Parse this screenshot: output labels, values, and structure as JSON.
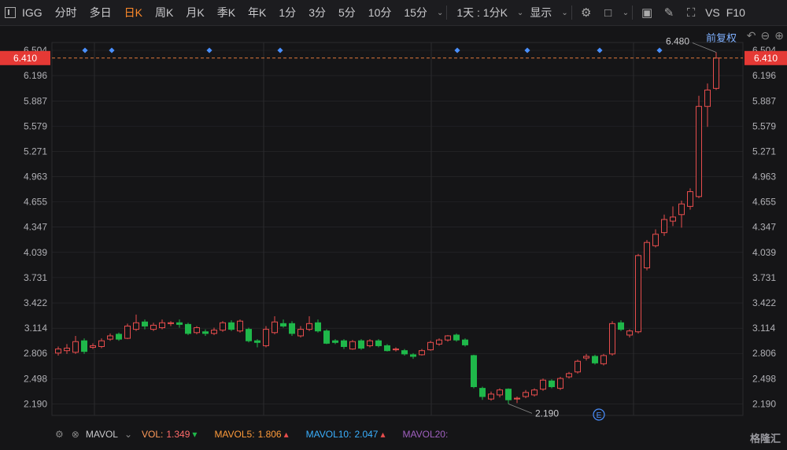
{
  "toolbar": {
    "symbol": "IGG",
    "periods": [
      "分时",
      "多日",
      "日K",
      "周K",
      "月K",
      "季K",
      "年K",
      "1分",
      "3分",
      "5分",
      "10分",
      "15分"
    ],
    "active_period": "日K",
    "interval_select": "1天 : 1分K",
    "display_label": "显示",
    "vs_label": "VS",
    "f10_label": "F10"
  },
  "chart_header": {
    "adjust_label": "前复权"
  },
  "price_marker": {
    "current": "6.410",
    "color": "#e53935",
    "high_label": "6.480",
    "low_label": "2.190",
    "event_badge": "E"
  },
  "colors": {
    "up": "#e84d4d",
    "down": "#1fb84a",
    "grid": "#2a2a2e",
    "background": "#151517",
    "accent": "#ff8a2a"
  },
  "chart_data": {
    "type": "candlestick",
    "y_ticks": [
      "6.504",
      "6.196",
      "5.887",
      "5.579",
      "5.271",
      "4.963",
      "4.655",
      "4.347",
      "4.039",
      "3.731",
      "3.422",
      "3.114",
      "2.806",
      "2.498",
      "2.190"
    ],
    "ylim": [
      2.05,
      6.6
    ],
    "candles": [
      [
        2.81,
        2.86,
        2.89,
        2.78
      ],
      [
        2.84,
        2.87,
        2.92,
        2.8
      ],
      [
        2.82,
        2.95,
        3.02,
        2.8
      ],
      [
        2.96,
        2.83,
        2.99,
        2.8
      ],
      [
        2.88,
        2.9,
        2.93,
        2.86
      ],
      [
        2.89,
        2.96,
        2.99,
        2.87
      ],
      [
        2.98,
        3.02,
        3.05,
        2.96
      ],
      [
        3.04,
        2.98,
        3.06,
        2.96
      ],
      [
        2.99,
        3.14,
        3.17,
        2.98
      ],
      [
        3.1,
        3.18,
        3.28,
        3.08
      ],
      [
        3.19,
        3.14,
        3.22,
        3.1
      ],
      [
        3.1,
        3.15,
        3.18,
        3.08
      ],
      [
        3.12,
        3.18,
        3.22,
        3.1
      ],
      [
        3.17,
        3.18,
        3.2,
        3.14
      ],
      [
        3.18,
        3.16,
        3.22,
        3.12
      ],
      [
        3.16,
        3.05,
        3.18,
        3.03
      ],
      [
        3.06,
        3.12,
        3.14,
        3.04
      ],
      [
        3.07,
        3.05,
        3.1,
        3.02
      ],
      [
        3.05,
        3.09,
        3.12,
        3.03
      ],
      [
        3.09,
        3.18,
        3.2,
        3.07
      ],
      [
        3.18,
        3.1,
        3.21,
        3.08
      ],
      [
        3.08,
        3.2,
        3.22,
        3.06
      ],
      [
        3.1,
        2.96,
        3.12,
        2.94
      ],
      [
        2.96,
        2.94,
        2.98,
        2.88
      ],
      [
        2.9,
        3.1,
        3.14,
        2.88
      ],
      [
        3.06,
        3.19,
        3.26,
        3.04
      ],
      [
        3.17,
        3.14,
        3.22,
        3.12
      ],
      [
        3.17,
        3.05,
        3.2,
        3.02
      ],
      [
        3.02,
        3.1,
        3.14,
        3.0
      ],
      [
        3.1,
        3.17,
        3.26,
        3.08
      ],
      [
        3.18,
        3.08,
        3.22,
        3.06
      ],
      [
        3.08,
        2.93,
        3.1,
        2.92
      ],
      [
        2.96,
        2.94,
        2.98,
        2.92
      ],
      [
        2.96,
        2.89,
        2.98,
        2.86
      ],
      [
        2.86,
        2.95,
        2.97,
        2.85
      ],
      [
        2.96,
        2.87,
        2.98,
        2.85
      ],
      [
        2.9,
        2.96,
        2.98,
        2.88
      ],
      [
        2.96,
        2.9,
        2.98,
        2.88
      ],
      [
        2.9,
        2.84,
        2.92,
        2.83
      ],
      [
        2.85,
        2.86,
        2.88,
        2.83
      ],
      [
        2.84,
        2.8,
        2.86,
        2.78
      ],
      [
        2.79,
        2.77,
        2.81,
        2.74
      ],
      [
        2.79,
        2.84,
        2.86,
        2.78
      ],
      [
        2.85,
        2.94,
        2.96,
        2.84
      ],
      [
        2.92,
        2.97,
        2.99,
        2.9
      ],
      [
        2.97,
        3.02,
        3.03,
        2.95
      ],
      [
        3.03,
        2.97,
        3.05,
        2.95
      ],
      [
        2.97,
        2.91,
        2.99,
        2.89
      ],
      [
        2.78,
        2.4,
        2.79,
        2.38
      ],
      [
        2.38,
        2.28,
        2.4,
        2.24
      ],
      [
        2.25,
        2.31,
        2.34,
        2.23
      ],
      [
        2.3,
        2.36,
        2.38,
        2.27
      ],
      [
        2.37,
        2.24,
        2.38,
        2.19
      ],
      [
        2.25,
        2.26,
        2.28,
        2.2
      ],
      [
        2.28,
        2.33,
        2.36,
        2.26
      ],
      [
        2.3,
        2.36,
        2.38,
        2.28
      ],
      [
        2.37,
        2.48,
        2.5,
        2.35
      ],
      [
        2.47,
        2.4,
        2.49,
        2.38
      ],
      [
        2.38,
        2.5,
        2.52,
        2.36
      ],
      [
        2.52,
        2.56,
        2.58,
        2.5
      ],
      [
        2.58,
        2.71,
        2.73,
        2.56
      ],
      [
        2.75,
        2.77,
        2.8,
        2.72
      ],
      [
        2.77,
        2.69,
        2.79,
        2.67
      ],
      [
        2.68,
        2.78,
        2.8,
        2.66
      ],
      [
        2.8,
        3.17,
        3.2,
        2.78
      ],
      [
        3.18,
        3.1,
        3.21,
        3.08
      ],
      [
        3.03,
        3.08,
        3.1,
        3.0
      ],
      [
        3.07,
        4.0,
        4.02,
        3.05
      ],
      [
        3.85,
        4.16,
        4.19,
        3.82
      ],
      [
        4.12,
        4.26,
        4.32,
        4.1
      ],
      [
        4.28,
        4.44,
        4.5,
        4.24
      ],
      [
        4.42,
        4.47,
        4.6,
        4.36
      ],
      [
        4.5,
        4.63,
        4.67,
        4.34
      ],
      [
        4.6,
        4.78,
        4.82,
        4.56
      ],
      [
        4.72,
        5.82,
        5.95,
        4.7
      ],
      [
        5.82,
        6.02,
        6.1,
        5.57
      ],
      [
        6.04,
        6.41,
        6.48,
        6.02
      ]
    ]
  },
  "volume_bar": {
    "indicator": "MAVOL",
    "vol_label": "VOL:",
    "vol_value": "1.349",
    "ma5_label": "MAVOL5:",
    "ma5_value": "1.806",
    "ma10_label": "MAVOL10:",
    "ma10_value": "2.047",
    "ma20_label": "MAVOL20:"
  },
  "watermark": "格隆汇"
}
